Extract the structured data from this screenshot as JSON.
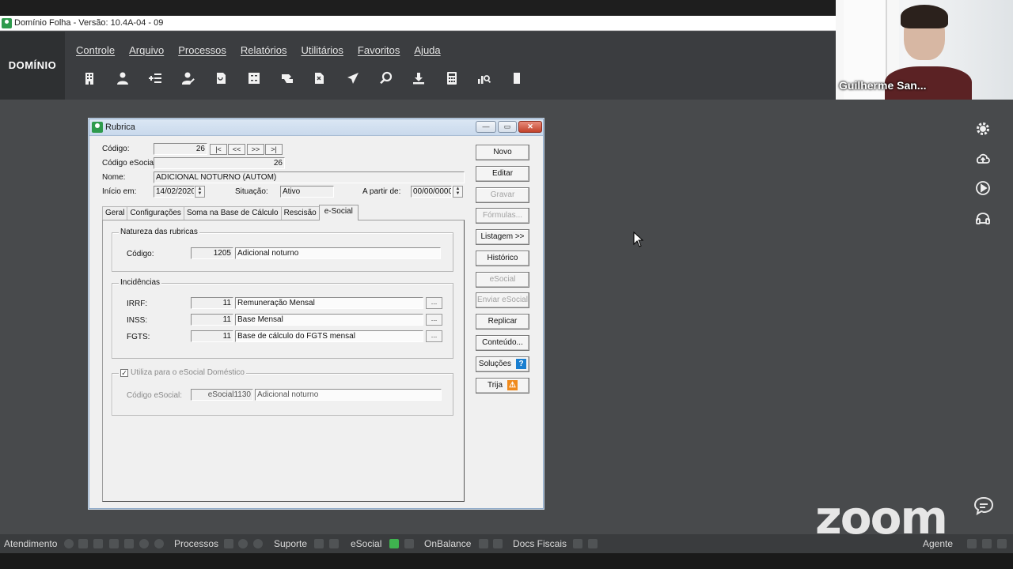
{
  "window": {
    "title": "Domínio Folha - Versão: 10.4A-04 - 09"
  },
  "brand": "DOMÍNIO",
  "menu": [
    "Controle",
    "Arquivo",
    "Processos",
    "Relatórios",
    "Utilitários",
    "Favoritos",
    "Ajuda"
  ],
  "toolbar_icons": [
    "building-icon",
    "user-icon",
    "list-add-icon",
    "user-edit-icon",
    "document-icon",
    "calculator-sheet-icon",
    "transfer-icon",
    "exit-document-icon",
    "airplane-icon",
    "search-icon",
    "download-icon",
    "calculator-icon",
    "chart-search-icon",
    "book-icon"
  ],
  "video": {
    "participant_name": "Guilherme San..."
  },
  "side_icons": [
    "gear-icon",
    "cloud-upload-icon",
    "play-icon",
    "headset-icon"
  ],
  "dialog": {
    "title": "Rubrica",
    "window_buttons": {
      "minimize": "—",
      "restore": "▭",
      "close": "✕"
    },
    "fields": {
      "codigo_label": "Código:",
      "codigo_value": "26",
      "nav_first": "|<",
      "nav_prev": "<<",
      "nav_next": ">>",
      "nav_last": ">|",
      "codigo_esocial_label": "Código eSocial:",
      "codigo_esocial_value": "26",
      "nome_label": "Nome:",
      "nome_value": "ADICIONAL NOTURNO (AUTOM)",
      "inicio_label": "Início em:",
      "inicio_value": "14/02/2020",
      "situacao_label": "Situação:",
      "situacao_value": "Ativo",
      "apartir_label": "A partir de:",
      "apartir_value": "00/00/0000"
    },
    "tabs": [
      "Geral",
      "Configurações",
      "Soma na Base de Cálculo",
      "Rescisão",
      "e-Social"
    ],
    "active_tab": "e-Social",
    "natureza": {
      "title": "Natureza das rubricas",
      "codigo_label": "Código:",
      "codigo_value": "1205",
      "descricao": "Adicional noturno"
    },
    "incidencias": {
      "title": "Incidências",
      "rows": [
        {
          "label": "IRRF:",
          "code": "11",
          "desc": "Remuneração Mensal"
        },
        {
          "label": "INSS:",
          "code": "11",
          "desc": "Base Mensal"
        },
        {
          "label": "FGTS:",
          "code": "11",
          "desc": "Base de cálculo do FGTS mensal"
        }
      ],
      "more": "..."
    },
    "domestico": {
      "checkbox_label": "Utiliza para o eSocial Doméstico",
      "checked": true,
      "codigo_label": "Código eSocial:",
      "codigo_value": "eSocial1130",
      "descricao": "Adicional noturno"
    },
    "buttons": [
      {
        "label": "Novo",
        "enabled": true
      },
      {
        "label": "Editar",
        "enabled": true
      },
      {
        "label": "Gravar",
        "enabled": false
      },
      {
        "label": "Fórmulas...",
        "enabled": false
      },
      {
        "label": "Listagem >>",
        "enabled": true
      },
      {
        "label": "Histórico",
        "enabled": true
      },
      {
        "label": "eSocial",
        "enabled": false
      },
      {
        "label": "Enviar eSocial",
        "enabled": false
      },
      {
        "label": "Replicar",
        "enabled": true
      },
      {
        "label": "Conteúdo...",
        "enabled": true
      },
      {
        "label": "Soluções",
        "enabled": true,
        "badge": "?",
        "badge_color": "#1a7fd0"
      },
      {
        "label": "Trija",
        "enabled": true,
        "badge": "⚠",
        "badge_color": "#f08a1c"
      }
    ]
  },
  "statusbar": {
    "atendimento": "Atendimento",
    "processos": "Processos",
    "suporte": "Suporte",
    "esocial": "eSocial",
    "onbalance": "OnBalance",
    "docs_fiscais": "Docs Fiscais",
    "agente": "Agente"
  },
  "zoom": {
    "logo": "zoom"
  },
  "colors": {
    "brand_green": "#2e9a4c",
    "header_bg": "#3b3d40",
    "desktop_bg": "#484a4c",
    "help_blue": "#1a7fd0",
    "trija_orange": "#f08a1c"
  }
}
